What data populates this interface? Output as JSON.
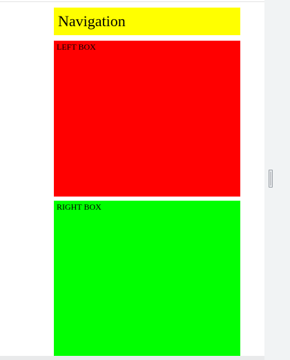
{
  "page": {
    "nav_title": "Navigation",
    "left_box_label": "LEFT BOX",
    "right_box_label": "RIGHT BOX"
  },
  "colors": {
    "nav": "#ffff00",
    "left_box": "#ff0000",
    "right_box": "#00ff00"
  },
  "icons": {
    "resize_handle": "drag-handle-icon"
  }
}
